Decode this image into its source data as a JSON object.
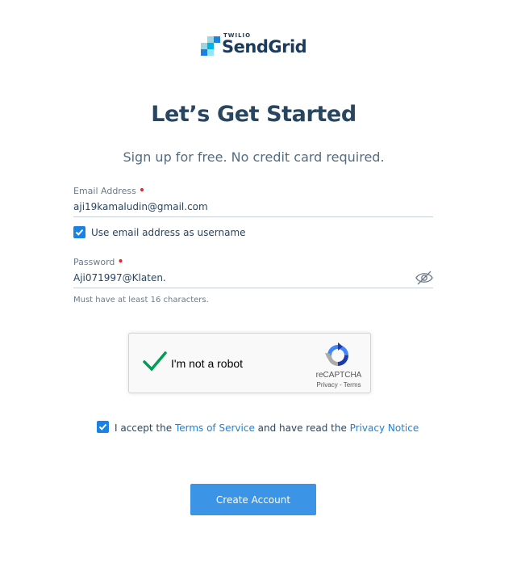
{
  "brand": {
    "parent": "TWILIO",
    "name": "SendGrid"
  },
  "header": {
    "title": "Let’s Get Started",
    "subtitle": "Sign up for free. No credit card required."
  },
  "form": {
    "email": {
      "label": "Email Address",
      "value": "aji19kamaludin@gmail.com",
      "required_marker": "•"
    },
    "use_email_as_username": {
      "label": "Use email address as username",
      "checked": true
    },
    "password": {
      "label": "Password",
      "value": "Aji071997@Klaten.",
      "required_marker": "•",
      "hint": "Must have at least 16 characters.",
      "toggle_icon": "eye-slash-icon"
    }
  },
  "captcha": {
    "label": "I'm not a robot",
    "brand": "reCAPTCHA",
    "privacy": "Privacy",
    "separator": " - ",
    "terms": "Terms",
    "checked": true
  },
  "terms_agreement": {
    "checked": true,
    "prefix": "I accept the ",
    "tos_link": "Terms of Service",
    "middle": " and have read the ",
    "privacy_link": "Privacy Notice"
  },
  "submit": {
    "label": "Create Account"
  },
  "colors": {
    "accent": "#1a82e2",
    "heading": "#294661",
    "required": "#e8202a",
    "captcha_check": "#009e55"
  }
}
